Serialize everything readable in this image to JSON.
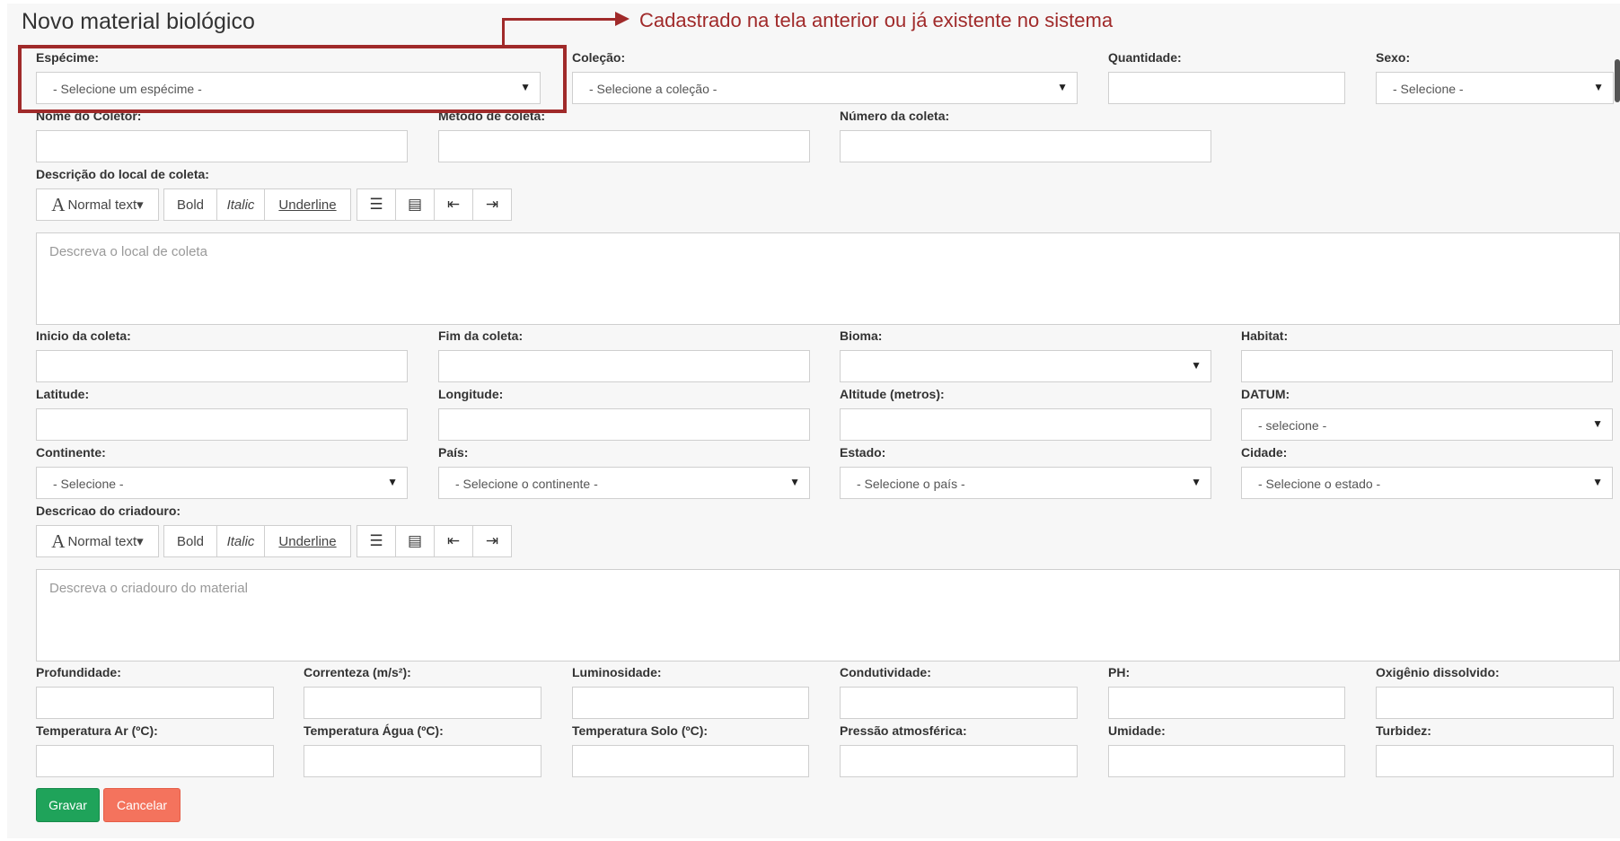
{
  "page": {
    "title": "Novo material biológico"
  },
  "annotation": {
    "text": "Cadastrado na tela anterior ou já existente  no sistema",
    "color": "#a02a2a"
  },
  "fields": {
    "especime": {
      "label": "Espécime:",
      "value": "- Selecione um espécime -"
    },
    "colecao": {
      "label": "Coleção:",
      "value": "- Selecione a coleção -"
    },
    "quantidade": {
      "label": "Quantidade:"
    },
    "sexo": {
      "label": "Sexo:",
      "value": "- Selecione -"
    },
    "nome_coletor": {
      "label": "Nome do Coletor:"
    },
    "metodo_coleta": {
      "label": "Método de coleta:"
    },
    "numero_coleta": {
      "label": "Número da coleta:"
    },
    "descricao_local": {
      "label": "Descrição do local de coleta:",
      "placeholder": "Descreva o local de coleta"
    },
    "inicio_coleta": {
      "label": "Inicio da coleta:"
    },
    "fim_coleta": {
      "label": "Fim da coleta:"
    },
    "bioma": {
      "label": "Bioma:",
      "value": ""
    },
    "habitat": {
      "label": "Habitat:"
    },
    "latitude": {
      "label": "Latitude:"
    },
    "longitude": {
      "label": "Longitude:"
    },
    "altitude": {
      "label": "Altitude (metros):"
    },
    "datum": {
      "label": "DATUM:",
      "value": "- selecione -"
    },
    "continente": {
      "label": "Continente:",
      "value": "- Selecione -"
    },
    "pais": {
      "label": "País:",
      "value": "- Selecione o continente -"
    },
    "estado": {
      "label": "Estado:",
      "value": "- Selecione o país -"
    },
    "cidade": {
      "label": "Cidade:",
      "value": "- Selecione o estado -"
    },
    "descricao_criadouro": {
      "label": "Descricao do criadouro:",
      "placeholder": "Descreva o criadouro do material"
    },
    "profundidade": {
      "label": "Profundidade:"
    },
    "correnteza": {
      "label": "Correnteza (m/s²):"
    },
    "luminosidade": {
      "label": "Luminosidade:"
    },
    "condutividade": {
      "label": "Condutividade:"
    },
    "ph": {
      "label": "PH:"
    },
    "oxigenio": {
      "label": "Oxigênio dissolvido:"
    },
    "temp_ar": {
      "label": "Temperatura Ar (ºC):"
    },
    "temp_agua": {
      "label": "Temperatura Água (ºC):"
    },
    "temp_solo": {
      "label": "Temperatura Solo (ºC):"
    },
    "pressao": {
      "label": "Pressão atmosférica:"
    },
    "umidade": {
      "label": "Umidade:"
    },
    "turbidez": {
      "label": "Turbidez:"
    }
  },
  "toolbar": {
    "normal_glyph": "A",
    "normal_text": "Normal text",
    "caret": "▾",
    "bold": "Bold",
    "italic": "Italic",
    "underline": "Underline",
    "icons": [
      "unordered-list-icon",
      "ordered-list-icon",
      "outdent-icon",
      "indent-icon"
    ]
  },
  "select_arrow": "▼",
  "actions": {
    "save": "Gravar",
    "cancel": "Cancelar"
  },
  "colors": {
    "save": "#1fa35a",
    "cancel": "#f4735d",
    "annotation": "#a02a2a"
  }
}
